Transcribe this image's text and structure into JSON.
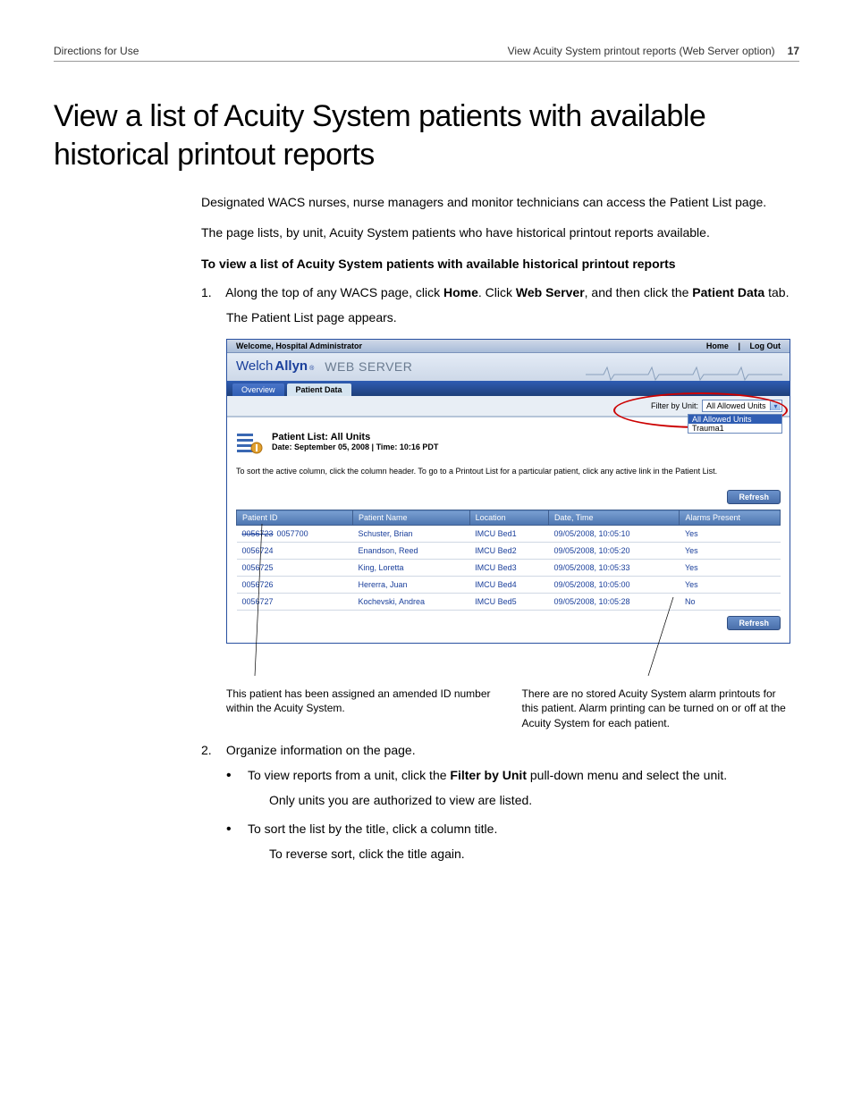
{
  "header": {
    "left": "Directions for Use",
    "right_title": "View Acuity System printout reports (Web Server option)",
    "page_num": "17"
  },
  "h1": "View a list of Acuity System patients with available historical printout reports",
  "intro1": "Designated WACS nurses, nurse managers and monitor technicians can access the Patient List page.",
  "intro2": "The page lists, by unit, Acuity System patients who have historical printout reports available.",
  "task_heading": "To view a list of Acuity System patients with available historical printout reports",
  "step1": {
    "num": "1.",
    "text_pre": "Along the top of any WACS page, click ",
    "b1": "Home",
    "text_mid": ". Click ",
    "b2": "Web Server",
    "text_mid2": ", and then click the ",
    "b3": "Patient Data",
    "text_post": " tab.",
    "result": "The Patient List page appears."
  },
  "shot": {
    "welcome": "Welcome, Hospital Administrator",
    "links": {
      "home": "Home",
      "logout": "Log Out"
    },
    "logo": {
      "a": "Welch",
      "b": "Allyn"
    },
    "ws": "WEB SERVER",
    "tabs": {
      "overview": "Overview",
      "patientdata": "Patient Data"
    },
    "filter_label": "Filter by Unit:",
    "filter_value": "All Allowed Units",
    "filter_options": {
      "o1": "All Allowed Units",
      "o2": "Trauma1"
    },
    "pl_title": "Patient List: All Units",
    "pl_sub": "Date: September 05, 2008  |  Time: 10:16 PDT",
    "hint": "To sort the active column, click the column header. To go to a Printout List for a particular patient, click any active link in the Patient List.",
    "refresh": "Refresh",
    "cols": {
      "id": "Patient ID",
      "name": "Patient Name",
      "loc": "Location",
      "dt": "Date, Time",
      "al": "Alarms Present"
    },
    "rows": [
      {
        "id_strike": "0056723",
        "id": "0057700",
        "name": "Schuster, Brian",
        "loc": "IMCU Bed1",
        "dt": "09/05/2008, 10:05:10",
        "al": "Yes"
      },
      {
        "id": "0056724",
        "name": "Enandson, Reed",
        "loc": "IMCU Bed2",
        "dt": "09/05/2008, 10:05:20",
        "al": "Yes"
      },
      {
        "id": "0056725",
        "name": "King, Loretta",
        "loc": "IMCU Bed3",
        "dt": "09/05/2008, 10:05:33",
        "al": "Yes"
      },
      {
        "id": "0056726",
        "name": "Hererra, Juan",
        "loc": "IMCU Bed4",
        "dt": "09/05/2008, 10:05:00",
        "al": "Yes"
      },
      {
        "id": "0056727",
        "name": "Kochevski, Andrea",
        "loc": "IMCU Bed5",
        "dt": "09/05/2008, 10:05:28",
        "al": "No"
      }
    ]
  },
  "annot": {
    "left": "This patient has been assigned an amended ID number within the Acuity System.",
    "right": "There are no stored Acuity System alarm printouts for this patient. Alarm printing can be turned on or off at the Acuity System for each patient."
  },
  "step2": {
    "num": "2.",
    "text": "Organize information on the page.",
    "b1_pre": "To view reports from a unit, click the ",
    "b1_bold": "Filter by Unit",
    "b1_post": " pull-down menu and select the unit.",
    "b1_sub": "Only units you are authorized to view are listed.",
    "b2": "To sort the list by the title, click a column title.",
    "b2_sub": "To reverse sort, click the title again."
  }
}
